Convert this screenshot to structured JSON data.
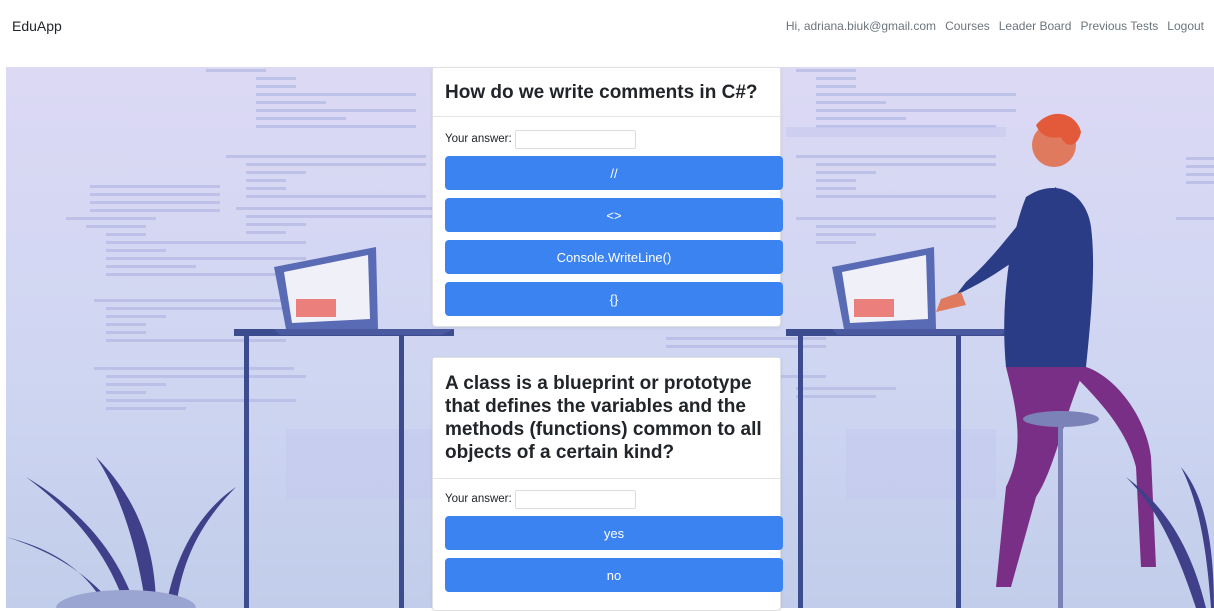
{
  "navbar": {
    "brand": "EduApp",
    "greeting": "Hi, adriana.biuk@gmail.com",
    "links": [
      "Courses",
      "Leader Board",
      "Previous Tests",
      "Logout"
    ]
  },
  "questions": [
    {
      "text": "How do we write comments in C#?",
      "answer_label": "Your answer:",
      "answer_value": "",
      "options": [
        "//",
        "<>",
        "Console.WriteLine()",
        "{}"
      ]
    },
    {
      "text": "A class is a blueprint or prototype that defines the variables and the methods (functions) common to all objects of a certain kind?",
      "answer_label": "Your answer:",
      "answer_value": "",
      "options": [
        "yes",
        "no"
      ]
    }
  ],
  "colors": {
    "button": "#3a83f1",
    "background": "#d6d8f2",
    "shirt": "#2b3c86",
    "pants": "#7a2f86",
    "skin": "#e07a5f"
  }
}
